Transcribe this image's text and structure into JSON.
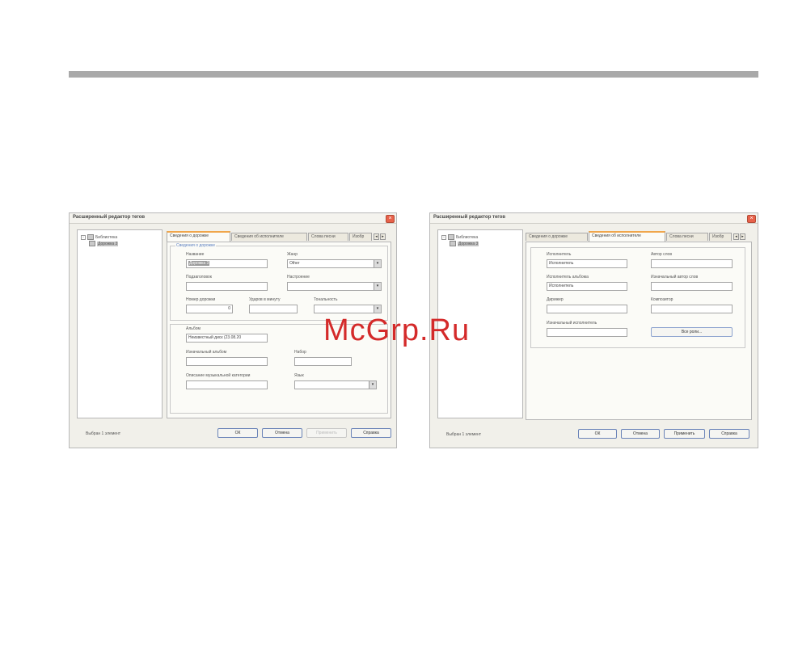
{
  "watermark": "McGrp.Ru",
  "dialog_left": {
    "title": "Расширенный редактор тегов",
    "tree": {
      "root": "Библиотека",
      "child": "Дорожка 3"
    },
    "tabs": [
      "Сведения о дорожке",
      "Сведения об исполнителе",
      "Слова песни",
      "Изобр"
    ],
    "group_title": "Сведения о дорожке",
    "fields": {
      "title_label": "Название",
      "title_value": "Дорожка 3",
      "genre_label": "Жанр",
      "genre_value": "Other",
      "subtitle_label": "Подзаголовок",
      "subtitle_value": "",
      "mood_label": "Настроение",
      "mood_value": "",
      "track_label": "Номер дорожки",
      "track_value": "0",
      "bpm_label": "Ударов в минуту",
      "bpm_value": "",
      "key_label": "Тональность",
      "key_value": "",
      "album_label": "Альбом",
      "album_value": "Неизвестный диск (23.08.20",
      "orig_album_label": "Изначальный альбом",
      "orig_album_value": "",
      "set_label": "Набор",
      "set_value": "",
      "category_label": "Описание музыкальной категории",
      "category_value": "",
      "language_label": "Язык",
      "language_value": ""
    },
    "status": "Выбран 1 элемент",
    "buttons": {
      "ok": "ОК",
      "cancel": "Отмена",
      "apply": "Применить",
      "help": "Справка"
    }
  },
  "dialog_right": {
    "title": "Расширенный редактор тегов",
    "tree": {
      "root": "Библиотека",
      "child": "Дорожка 3"
    },
    "tabs": [
      "Сведения о дорожке",
      "Сведения об исполнителе",
      "Слова песни",
      "Изобр"
    ],
    "fields": {
      "artist_label": "Исполнитель",
      "artist_value": "Исполнитель",
      "lyricist_label": "Автор слов",
      "lyricist_value": "",
      "album_artist_label": "Исполнитель альбома",
      "album_artist_value": "Исполнитель",
      "orig_lyricist_label": "Изначальный автор слов",
      "orig_lyricist_value": "",
      "conductor_label": "Дирижер",
      "conductor_value": "",
      "composer_label": "Композитор",
      "composer_value": "",
      "orig_artist_label": "Изначальный исполнитель",
      "orig_artist_value": ""
    },
    "roles_button": "Все роли...",
    "status": "Выбран 1 элемент",
    "buttons": {
      "ok": "ОК",
      "cancel": "Отмена",
      "apply": "Применить",
      "help": "Справка"
    }
  }
}
